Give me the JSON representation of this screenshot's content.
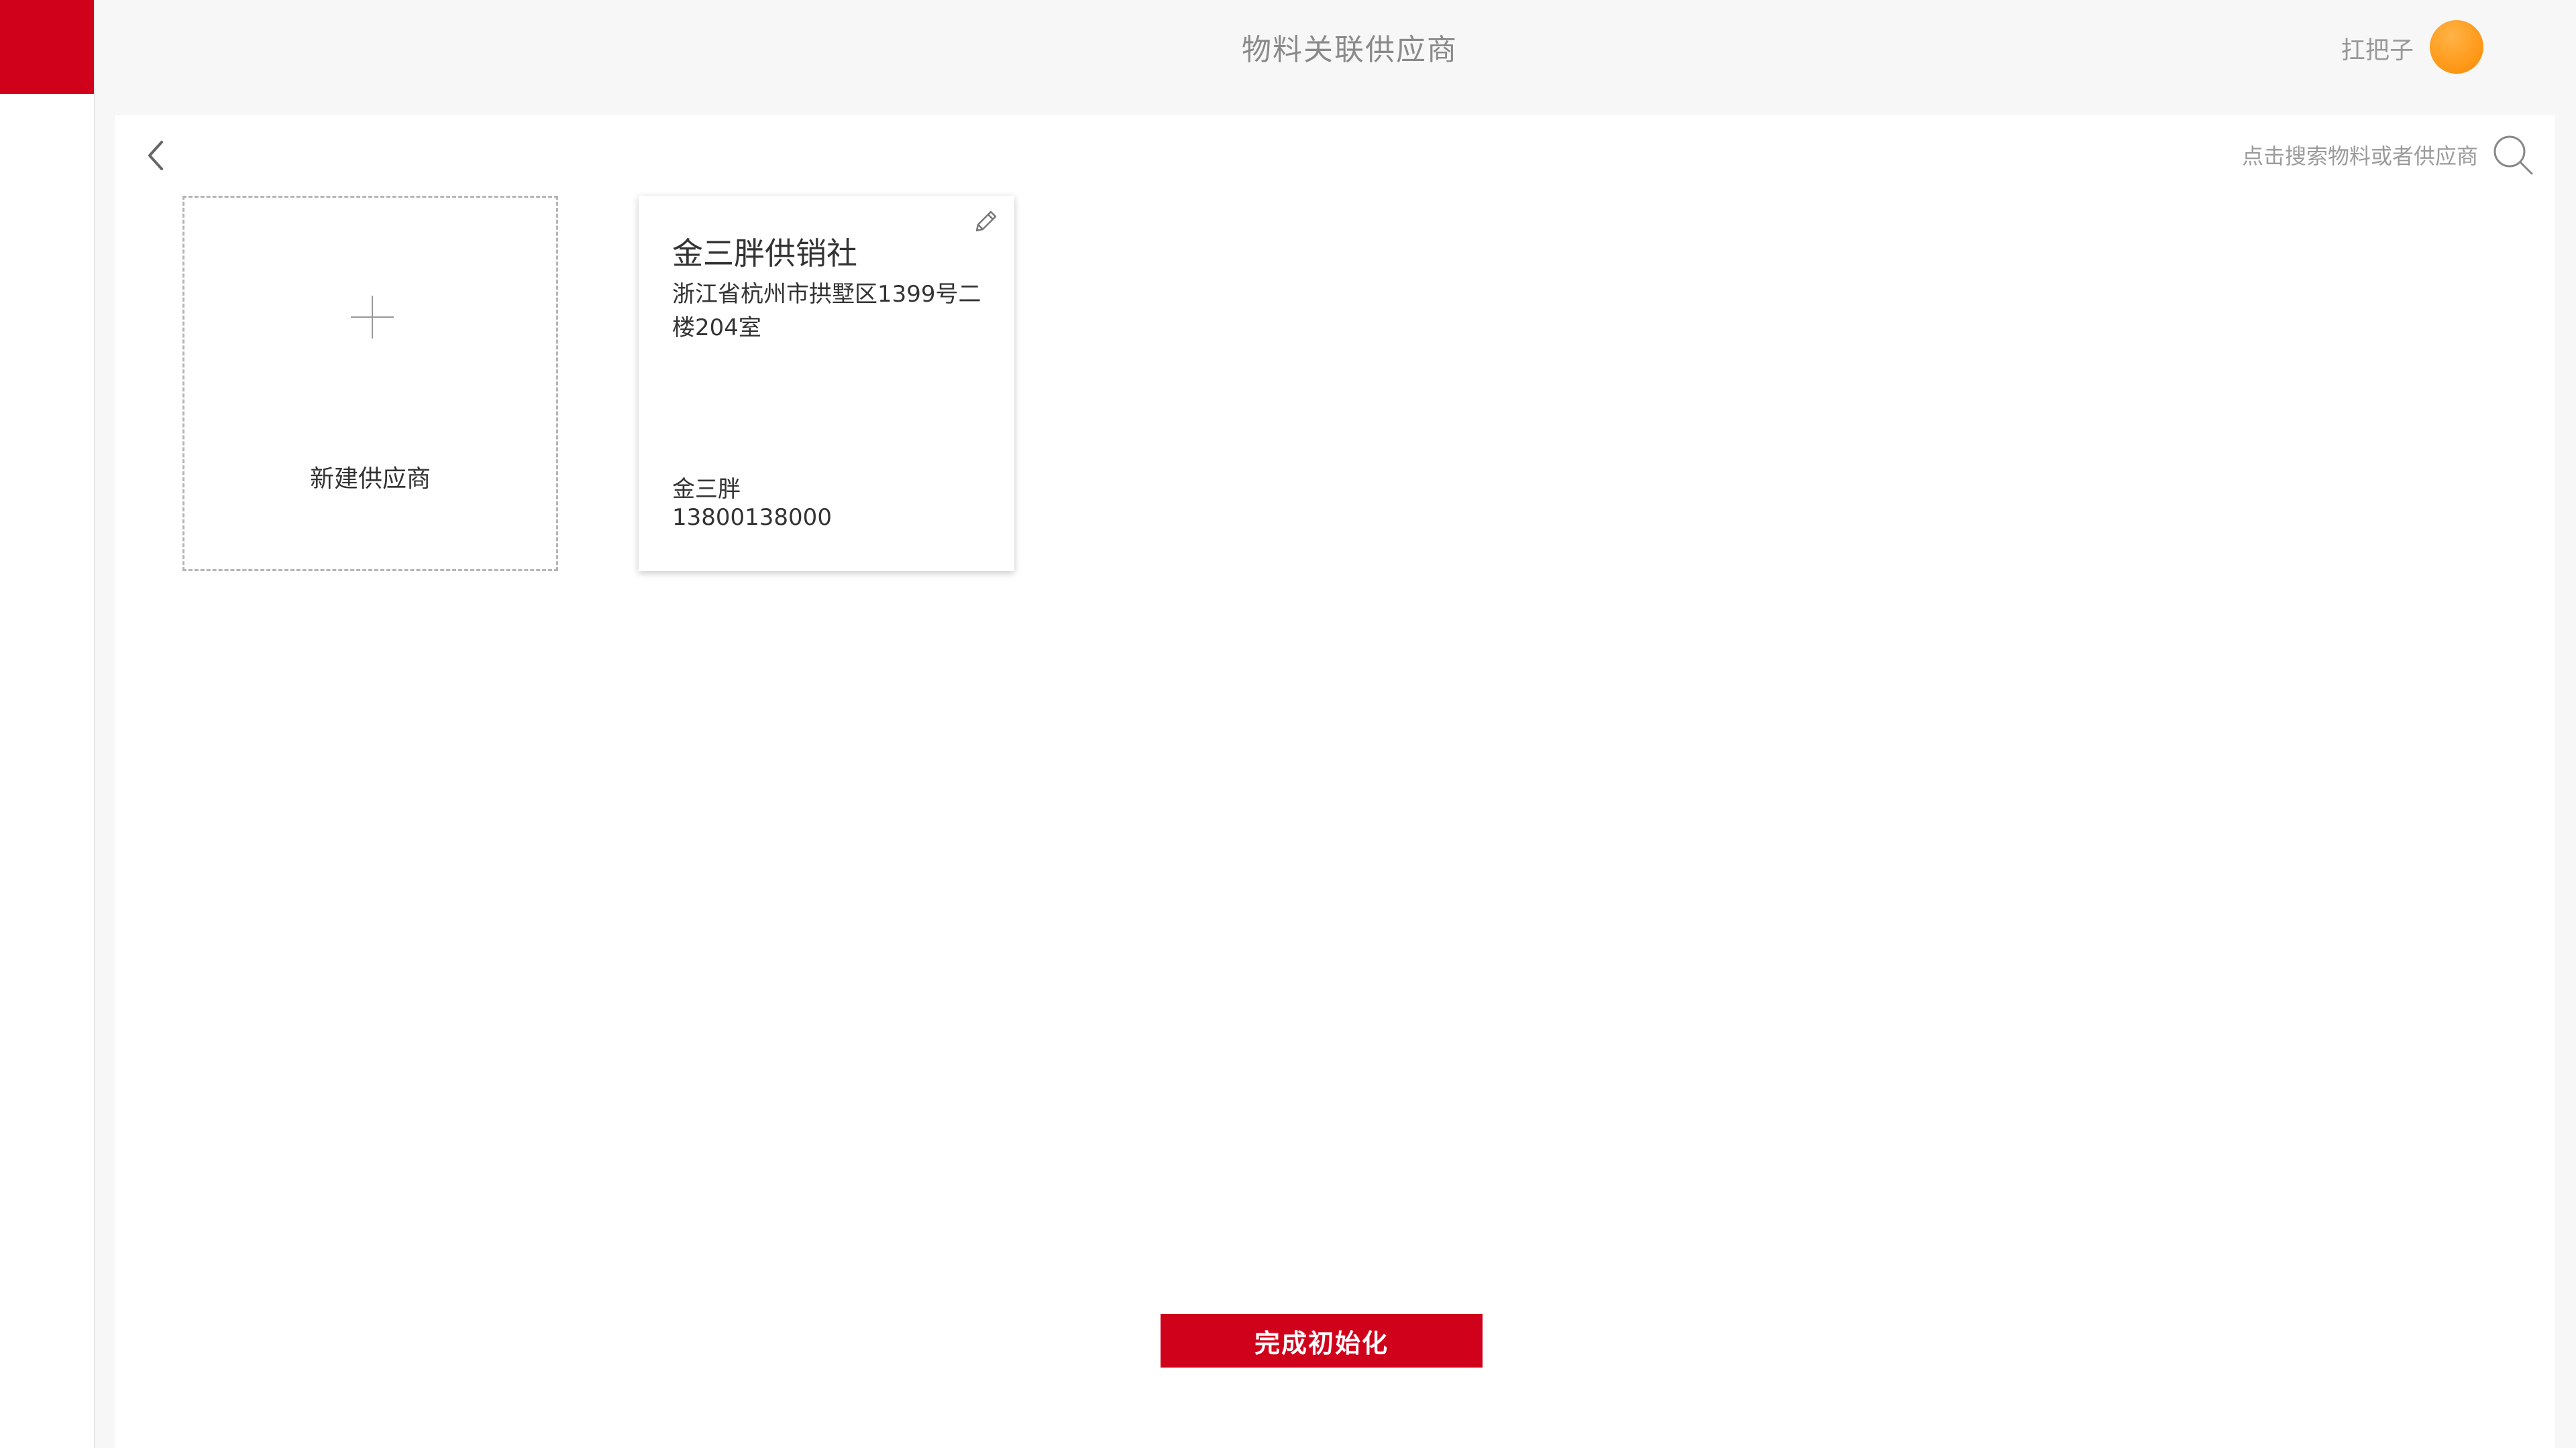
{
  "header": {
    "title": "物料关联供应商",
    "user_name": "扛把子"
  },
  "search": {
    "placeholder": "点击搜索物料或者供应商",
    "icon": "search-icon"
  },
  "new_supplier": {
    "label": "新建供应商",
    "icon": "plus-icon"
  },
  "suppliers": [
    {
      "name": "金三胖供销社",
      "address": "浙江省杭州市拱墅区1399号二楼204室",
      "contact": "金三胖",
      "phone": "13800138000"
    }
  ],
  "footer": {
    "finish_label": "完成初始化"
  },
  "colors": {
    "accent": "#d0021b",
    "avatar": "#ff9a1a",
    "background": "#f7f7f7"
  }
}
